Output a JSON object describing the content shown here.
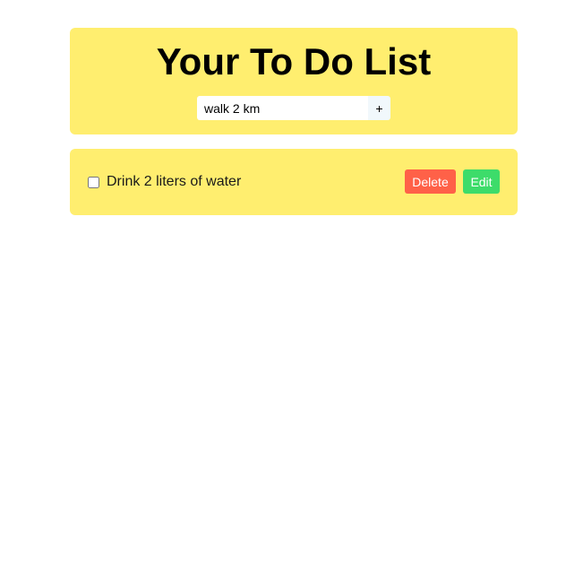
{
  "header": {
    "title": "Your To Do List"
  },
  "new_task": {
    "value": "walk 2 km",
    "add_label": "+"
  },
  "todos": [
    {
      "text": "Drink 2 liters of water",
      "checked": false,
      "delete_label": "Delete",
      "edit_label": "Edit"
    }
  ],
  "colors": {
    "card_background": "#ffee6f",
    "delete_button": "#ff6148",
    "edit_button": "#3ddc6a",
    "add_button": "#f1f8fc"
  }
}
